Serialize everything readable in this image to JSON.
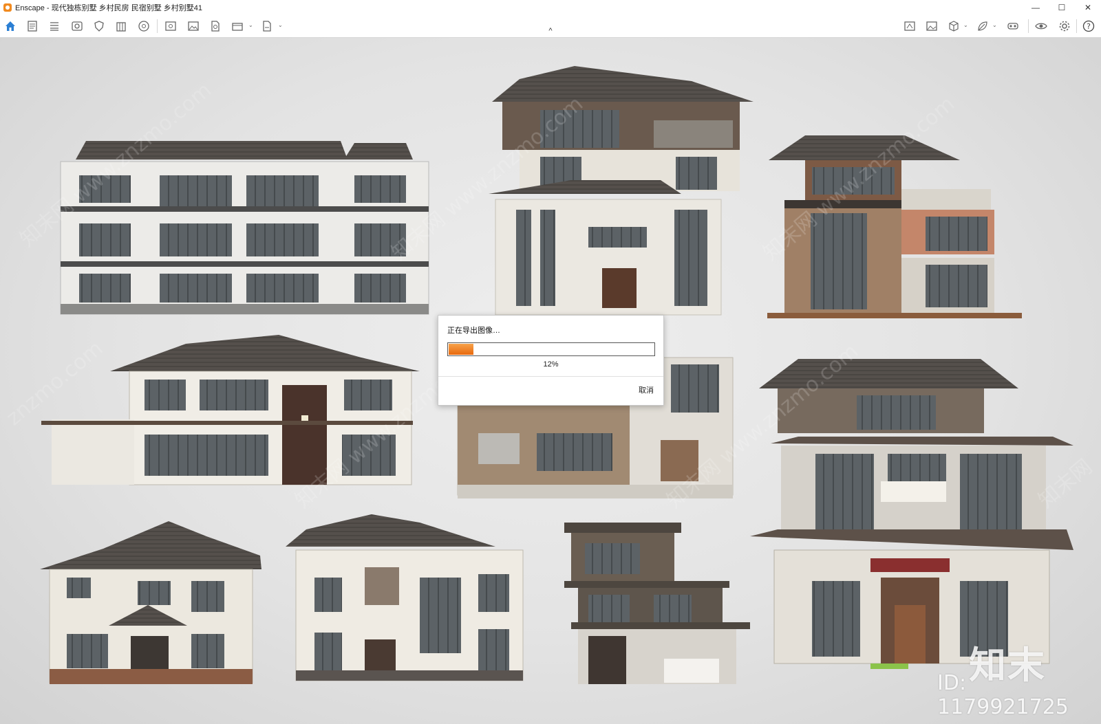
{
  "window": {
    "title": "Enscape - 现代独栋别墅 乡村民房 民宿别墅 乡村别墅41",
    "controls": [
      "—",
      "☐",
      "✕"
    ]
  },
  "toolbar": {
    "left_icons": [
      "home-icon",
      "document-icon",
      "bim-icon",
      "view-icon",
      "shield-icon",
      "building-icon",
      "asset-icon",
      "screenshot-icon",
      "image-icon",
      "batch-render-icon",
      "video-icon",
      "export-icon"
    ],
    "right_icons": [
      "map-icon",
      "image-settings-icon",
      "cube-icon",
      "leaf-icon",
      "vr-icon",
      "eye-icon",
      "settings-icon",
      "help-icon"
    ],
    "collapse": "^"
  },
  "dialog": {
    "title": "正在导出图像…",
    "progress_value": 0.12,
    "progress_text": "12%",
    "cancel_label": "取消",
    "accent_color": "#e8690e"
  },
  "watermark": {
    "logo": "知末",
    "id_text": "ID: 1179921725"
  }
}
